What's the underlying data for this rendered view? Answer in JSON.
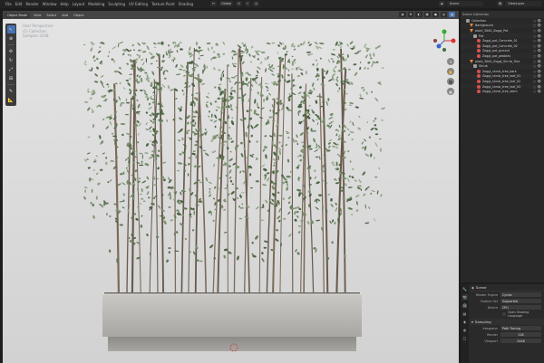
{
  "topbar": {
    "menus": [
      "File",
      "Edit",
      "Render",
      "Window",
      "Help",
      "Layout",
      "Modeling",
      "Sculpting",
      "UV Editing",
      "Texture Paint",
      "Shading"
    ],
    "transform_orientation": "Global",
    "scene_label": "Scene",
    "view_layer_label": "ViewLayer",
    "options_label": "Options"
  },
  "viewport": {
    "mode": "Object Mode",
    "header_menus": [
      "View",
      "Select",
      "Add",
      "Object"
    ],
    "info_lines": [
      "User Perspective",
      "(1) Collection",
      "Samples 2048"
    ],
    "nav_buttons": [
      "+",
      "✋",
      "🎥",
      "▦"
    ]
  },
  "outliner": {
    "header": "Scene Collection",
    "rows": [
      {
        "label": "Collection",
        "indent": 1,
        "icon": "coll"
      },
      {
        "label": "Background",
        "indent": 2,
        "icon": "obj"
      },
      {
        "label": "plant_3000_Zoggi_Pot",
        "indent": 2,
        "icon": "obj"
      },
      {
        "label": "Pot",
        "indent": 3,
        "icon": "coll"
      },
      {
        "label": "Zoggi_pot_Concrete_01",
        "indent": 4,
        "icon": "mesh"
      },
      {
        "label": "Zoggi_pot_Concrete_02",
        "indent": 4,
        "icon": "mesh"
      },
      {
        "label": "Zoggi_pot_ground",
        "indent": 4,
        "icon": "mesh"
      },
      {
        "label": "Zoggi_pot_pebbles",
        "indent": 4,
        "icon": "mesh"
      },
      {
        "label": "plant_3000_Zoggi_Shrub_Tree",
        "indent": 2,
        "icon": "obj"
      },
      {
        "label": "Shrub",
        "indent": 3,
        "icon": "coll"
      },
      {
        "label": "Zoggi_shrub_tree_bark",
        "indent": 4,
        "icon": "mesh"
      },
      {
        "label": "Zoggi_shrub_tree_leaf_01",
        "indent": 4,
        "icon": "mesh"
      },
      {
        "label": "Zoggi_shrub_tree_leaf_02",
        "indent": 4,
        "icon": "mesh"
      },
      {
        "label": "Zoggi_shrub_tree_leaf_03",
        "indent": 4,
        "icon": "mesh"
      },
      {
        "label": "Zoggi_shrub_tree_stem",
        "indent": 4,
        "icon": "mesh"
      }
    ]
  },
  "properties": {
    "title": "Scene",
    "render_engine_label": "Render Engine",
    "render_engine": "Cycles",
    "feature_set_label": "Feature Set",
    "feature_set": "Supported",
    "device_label": "Device",
    "device": "CPU",
    "osl_label": "Open Shading Language",
    "sampling_label": "Sampling",
    "integrator_label": "Integrator",
    "integrator": "Path Tracing",
    "render_label": "Render",
    "render_samples": "128",
    "viewport_label": "Viewport",
    "viewport_samples": "2048"
  },
  "colors": {
    "accent": "#4772b3",
    "viewport_bg": "#dcdcdc",
    "panel_bg": "#282828"
  }
}
